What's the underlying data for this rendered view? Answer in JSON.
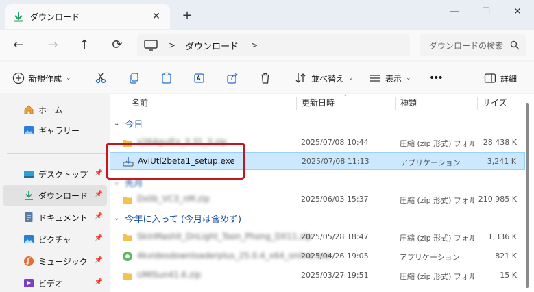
{
  "window": {
    "tab_title": "ダウンロード",
    "new_tab": "+",
    "controls": {
      "minimize": "—",
      "maximize": "☐",
      "close": "✕"
    }
  },
  "nav": {
    "back": "←",
    "forward": "→",
    "up": "↑",
    "refresh": "⟳",
    "breadcrumb": [
      "ダウンロード"
    ],
    "search_placeholder": "ダウンロードの検索"
  },
  "commands": {
    "new": "新規作成",
    "sort": "並べ替え",
    "view": "表示",
    "more": "•••",
    "details": "詳細"
  },
  "sidebar": {
    "items": [
      {
        "label": "ホーム",
        "icon": "home-icon"
      },
      {
        "label": "ギャラリー",
        "icon": "gallery-icon"
      },
      {
        "label": "デスクトップ",
        "icon": "desktop-icon",
        "pinned": "📌"
      },
      {
        "label": "ダウンロード",
        "icon": "download-icon",
        "pinned": "📌"
      },
      {
        "label": "ドキュメント",
        "icon": "document-icon",
        "pinned": "📌"
      },
      {
        "label": "ピクチャ",
        "icon": "pictures-icon",
        "pinned": "📌"
      },
      {
        "label": "ミュージック",
        "icon": "music-icon",
        "pinned": "📌"
      },
      {
        "label": "ビデオ",
        "icon": "video-icon",
        "pinned": "📌"
      }
    ]
  },
  "columns": {
    "name": "名前",
    "modified": "更新日時",
    "type": "種類",
    "size": "サイズ"
  },
  "groups": {
    "today": "今日",
    "last_month": "先月",
    "this_year": "今年に入って (今月は含めず)"
  },
  "files": [
    {
      "name": "x264guiEx_3.31_3.zip",
      "date": "2025/07/08 10:44",
      "type": "圧縮 (zip 形式) フォルダー",
      "size": "28,438 K"
    },
    {
      "name": "AviUtl2beta1_setup.exe",
      "date": "2025/07/08 11:13",
      "type": "アプリケーション",
      "size": "3,241 K"
    },
    {
      "name": "Dxlib_VC3_nM.zip",
      "date": "2025/06/03 15:37",
      "type": "圧縮 (zip 形式) フォルダー",
      "size": "210,985 K"
    },
    {
      "name": "SkinMashit_DnLight_Toon_Phong_DX11.zip",
      "date": "2025/05/28 18:47",
      "type": "圧縮 (zip 形式) フォルダー",
      "size": "1,336 K"
    },
    {
      "name": "4kvideodownloaderplus_25.0.4_x64_online.exe",
      "date": "2025/04/26 19:05",
      "type": "アプリケーション",
      "size": "821 K"
    },
    {
      "name": "UMISun41.6.zip",
      "date": "2025/03/27 19:51",
      "type": "圧縮 (zip 形式) フォルダー",
      "size": "15 K"
    }
  ],
  "colors": {
    "selection": "#cce8ff",
    "highlight_box": "#c0181f",
    "group_text": "#1a4fa0",
    "download_accent": "#1f9f6a"
  }
}
